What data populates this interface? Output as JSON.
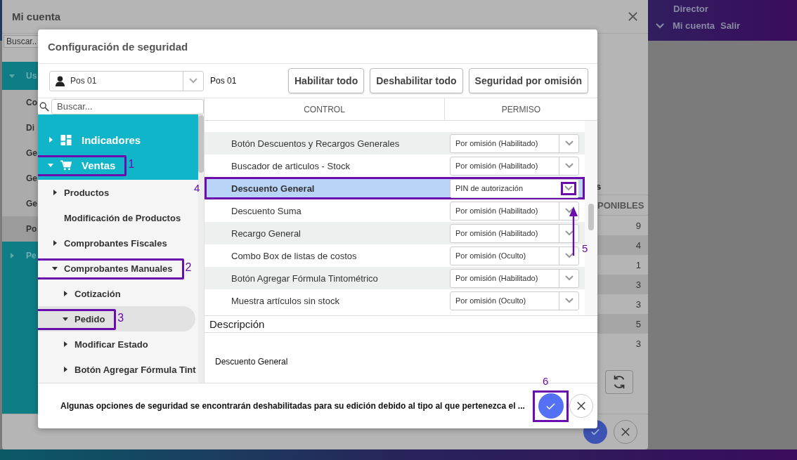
{
  "page_header": {
    "user_role": "Director",
    "links": [
      "Mi cuenta",
      "Salir"
    ]
  },
  "account_dialog": {
    "title": "Mi cuenta",
    "search": {
      "placeholder": "Buscar.."
    },
    "menu": [
      {
        "label": "Us",
        "kind": "group",
        "expanded": true,
        "selected": false
      },
      {
        "label": "Co",
        "kind": "item",
        "selected": false
      },
      {
        "label": "Di",
        "kind": "item",
        "selected": false
      },
      {
        "label": "Ge",
        "kind": "item",
        "selected": false
      },
      {
        "label": "Ge",
        "kind": "item",
        "selected": false
      },
      {
        "label": "Ge",
        "kind": "item",
        "selected": false
      },
      {
        "label": "Po",
        "kind": "item",
        "selected": true
      },
      {
        "label": "Pe",
        "kind": "group",
        "expanded": false,
        "selected": false
      }
    ],
    "table_fragment": "s",
    "column": "PONIBLES",
    "values": [
      "9",
      "4",
      "1",
      "3",
      "3",
      "5",
      "3"
    ]
  },
  "security_dialog": {
    "title": "Configuración de seguridad",
    "profile_select": {
      "value": "Pos 01"
    },
    "profile_name": "Pos 01",
    "buttons": [
      "Habilitar todo",
      "Deshabilitar todo",
      "Seguridad por omisión"
    ],
    "tree": {
      "search": {
        "placeholder": "Buscar..."
      },
      "items": [
        {
          "label": "Indicadores",
          "expanded": false,
          "selected": false
        },
        {
          "label": "Ventas",
          "expanded": true,
          "selected": false,
          "marker": "1",
          "children": [
            {
              "label": "Productos",
              "expanded": false,
              "selected": false
            },
            {
              "label": "Modificación de Productos",
              "selected": false
            },
            {
              "label": "Comprobantes Fiscales",
              "expanded": false,
              "selected": false
            },
            {
              "label": "Comprobantes Manuales",
              "expanded": true,
              "selected": false,
              "marker": "2",
              "children": [
                {
                  "label": "Cotización",
                  "expanded": false,
                  "selected": false
                },
                {
                  "label": "Pedido",
                  "expanded": true,
                  "selected": true,
                  "marker": "3"
                },
                {
                  "label": "Modificar Estado",
                  "expanded": false,
                  "selected": false
                },
                {
                  "label": "Botón Agregar Fórmula Tint",
                  "expanded": false,
                  "selected": false
                }
              ]
            }
          ]
        }
      ]
    },
    "table": {
      "columns": [
        "CONTROL",
        "PERMISO"
      ],
      "rows": [
        {
          "control": "Botón Descuentos y Recargos Generales",
          "permission": "Por omisión (Habilitado)",
          "selected": false
        },
        {
          "control": "Buscador de articulos - Stock",
          "permission": "Por omisión (Habilitado)",
          "selected": false
        },
        {
          "control": "Descuento General",
          "permission": "PIN de autorización",
          "selected": true,
          "marker": "4",
          "dropdown_outlined": true,
          "arrow_marker": "5"
        },
        {
          "control": "Descuento Suma",
          "permission": "Por omisión (Habilitado)",
          "selected": false
        },
        {
          "control": "Recargo General",
          "permission": "Por omisión (Habilitado)",
          "selected": false
        },
        {
          "control": "Combo Box de listas de costos",
          "permission": "Por omisión (Oculto)",
          "selected": false
        },
        {
          "control": "Botón Agregar Fórmula Tintométrico",
          "permission": "Por omisión (Habilitado)",
          "selected": false
        },
        {
          "control": "Muestra artículos sin stock",
          "permission": "Por omisión (Oculto)",
          "selected": false
        }
      ]
    },
    "description": {
      "label": "Descripción",
      "text": "Descuento General"
    },
    "notice": "Algunas opciones de seguridad se encontrarán deshabilitadas para su edición debido al tipo al que pertenezca el ...",
    "confirm": {
      "marker": "6"
    }
  }
}
